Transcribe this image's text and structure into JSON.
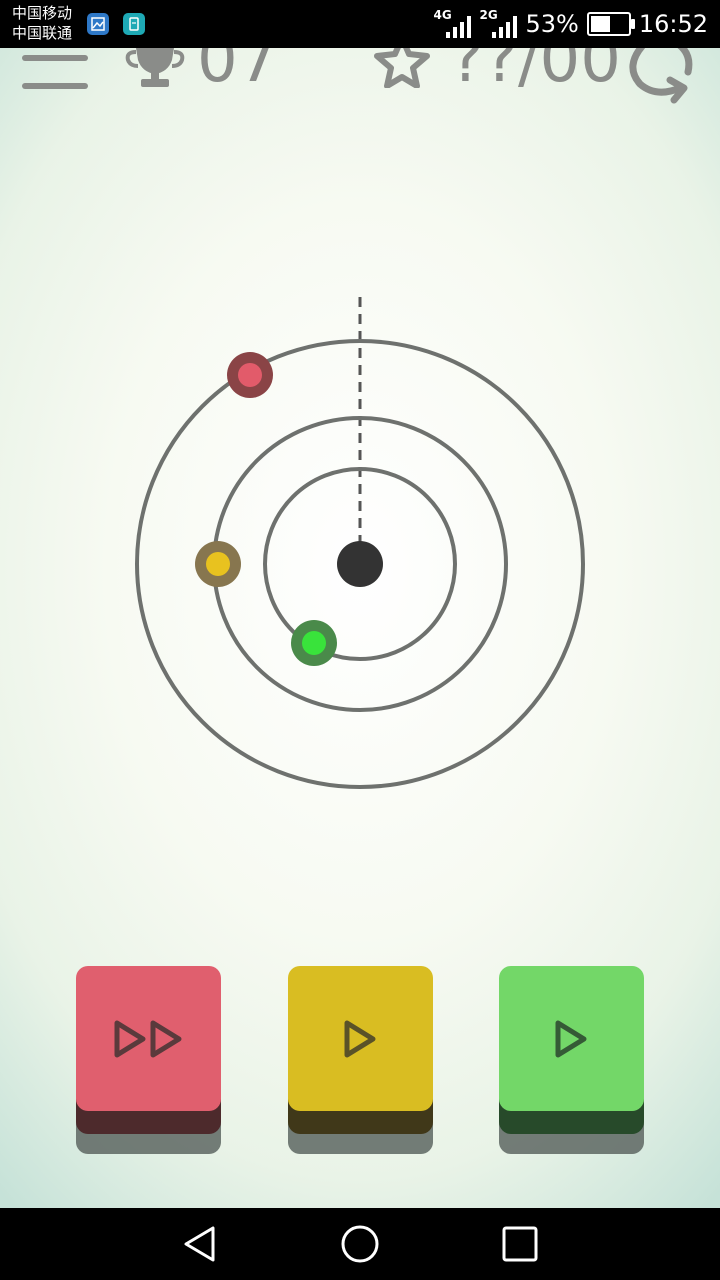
{
  "status_bar": {
    "carrier_1": "中国移动",
    "carrier_2": "中国联通",
    "network_1": "4G",
    "network_2": "2G",
    "battery_percent": "53%",
    "battery_level": 0.53,
    "time": "16:52"
  },
  "hud": {
    "level": "07",
    "stars": "??/00"
  },
  "planets": [
    {
      "name": "red",
      "ring": 3,
      "outer_color": "#8a4446",
      "inner_color": "#e25b6a"
    },
    {
      "name": "yellow",
      "ring": 2,
      "outer_color": "#87764f",
      "inner_color": "#e8c21f"
    },
    {
      "name": "green",
      "ring": 1,
      "outer_color": "#4a8a4a",
      "inner_color": "#39e33b"
    }
  ],
  "controls": [
    {
      "name": "fast-forward",
      "face_color": "#e05f6e",
      "base_color": "#4d2a2c",
      "icon": "double-play-icon"
    },
    {
      "name": "play-yellow",
      "face_color": "#d9bd22",
      "base_color": "#403819",
      "icon": "play-icon"
    },
    {
      "name": "play-green",
      "face_color": "#73d768",
      "base_color": "#274a2a",
      "icon": "play-icon"
    }
  ],
  "colors": {
    "ring": "#6e716e",
    "sun": "#333333",
    "icon_stroke": "#8a8c89"
  }
}
